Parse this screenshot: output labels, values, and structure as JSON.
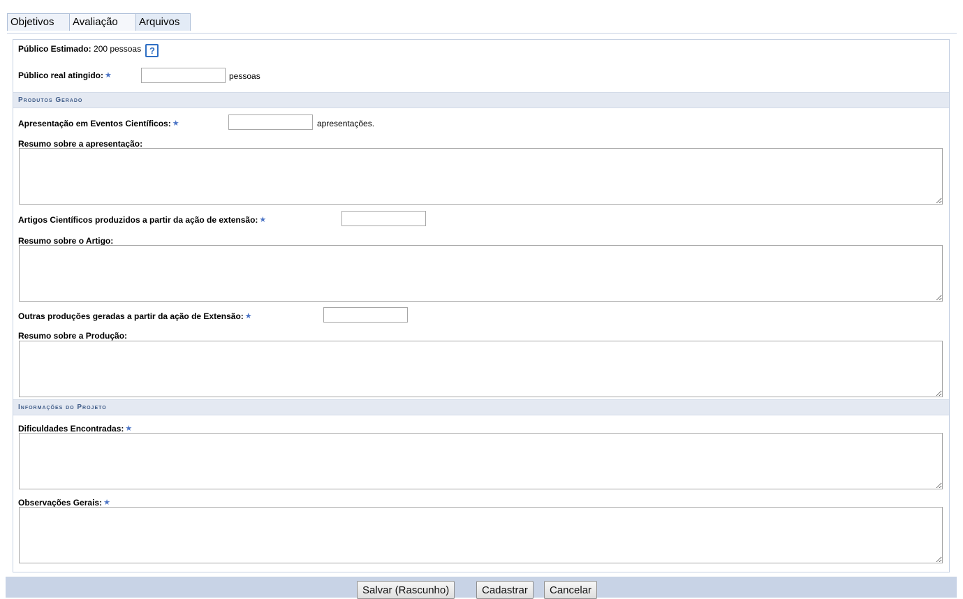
{
  "tabs": [
    {
      "label": "Objetivos"
    },
    {
      "label": "Avaliação"
    },
    {
      "label": "Arquivos"
    }
  ],
  "publico": {
    "estimado_label": "Público Estimado:",
    "estimado_value": "200 pessoas",
    "help_glyph": "?",
    "real_label": "Público real atingido:",
    "real_value": "",
    "real_unit": "pessoas"
  },
  "required_mark": "★",
  "produtos": {
    "section_title": "Produtos Gerado",
    "apresentacao_label": "Apresentação em Eventos Científicos:",
    "apresentacao_value": "",
    "apresentacao_unit": "apresentações.",
    "resumo_apresentacao_label": "Resumo sobre a apresentação:",
    "artigos_label": "Artigos Científicos produzidos a partir da ação de extensão:",
    "artigos_value": "",
    "resumo_artigo_label": "Resumo sobre o Artigo:",
    "outras_label": "Outras produções geradas a partir da ação de Extensão:",
    "outras_value": "",
    "resumo_producao_label": "Resumo sobre a Produção:"
  },
  "informacoes": {
    "section_title": "Informações do Projeto",
    "dificuldades_label": "Dificuldades Encontradas:",
    "observacoes_label": "Observações Gerais:"
  },
  "buttons": {
    "salvar": "Salvar (Rascunho)",
    "cadastrar": "Cadastrar",
    "cancelar": "Cancelar"
  },
  "icons": {
    "help": "help-icon",
    "required": "required-star-icon"
  }
}
